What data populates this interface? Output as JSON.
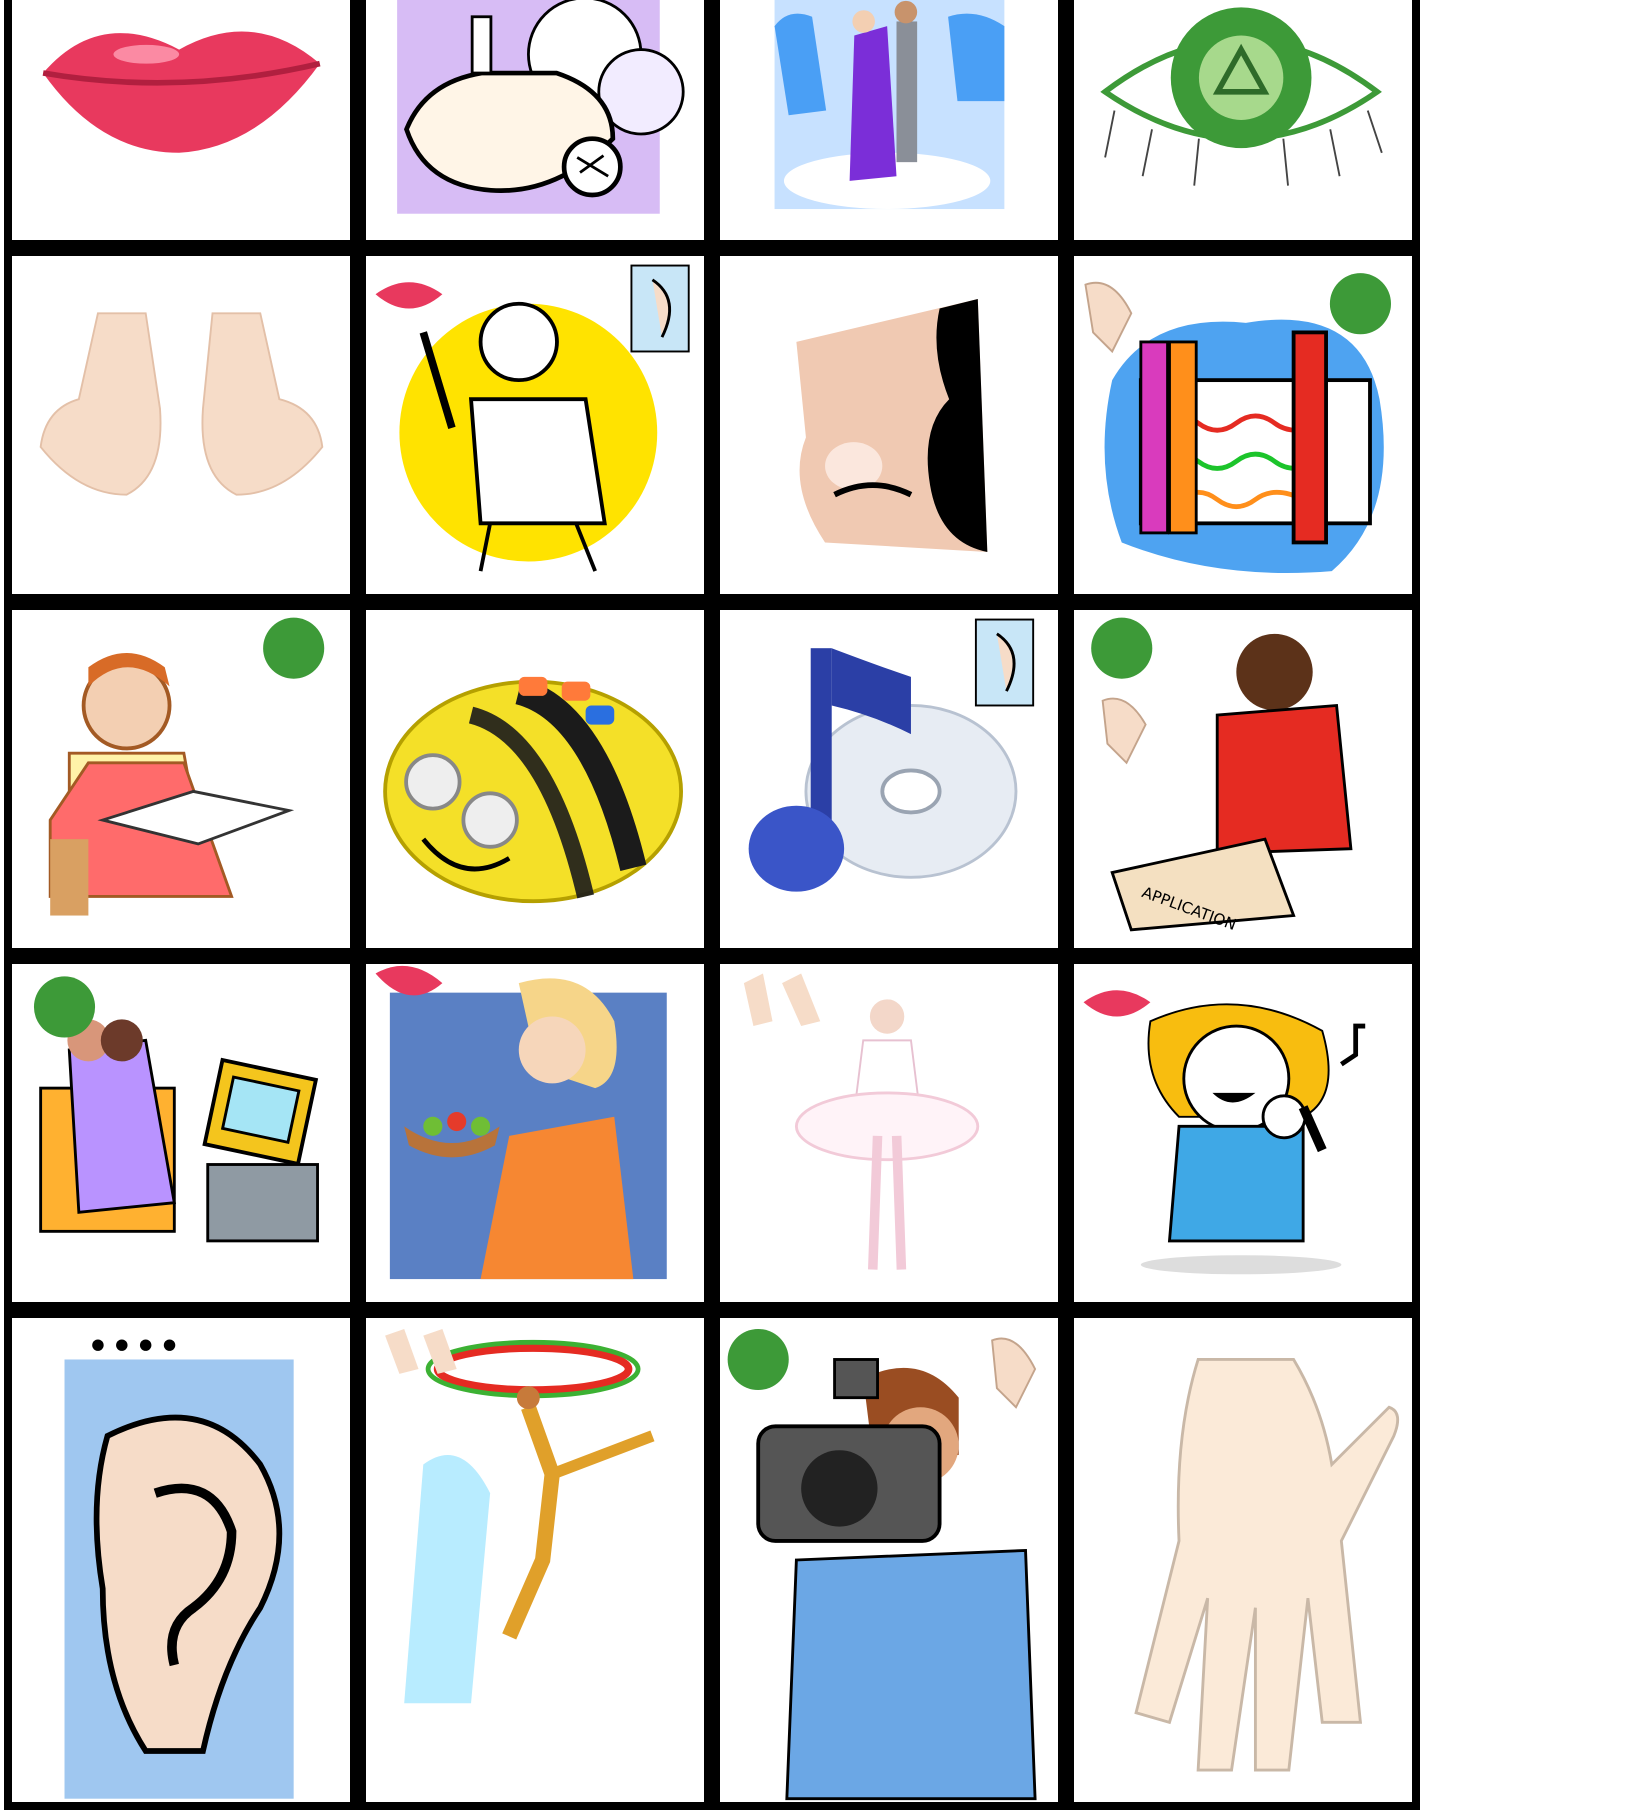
{
  "sheet": {
    "rows": [
      [
        "lips",
        "perfume",
        "dancing-couple",
        "eye"
      ],
      [
        "feet",
        "telephone-talker",
        "nose",
        "crayons-paper"
      ],
      [
        "girl-reading",
        "bee-bot-toy",
        "music-note-cd",
        "woman-writing-application"
      ],
      [
        "couple-watching-tv",
        "woman-eating-salad",
        "ballerina",
        "girl-singing"
      ],
      [
        "ear",
        "hula-hoop-dancer",
        "camera-operator",
        "hand"
      ]
    ],
    "printed_text": {
      "application_form": "APPLICATION"
    }
  },
  "colors": {
    "border": "#000000",
    "lip": "#e8395e",
    "eye_green": "#3d9a38",
    "skin_light": "#f6dcc8",
    "blue_silhouette": "#4a9ff5",
    "purple_dress": "#7b2ed8",
    "yellow": "#ffe300",
    "red": "#e52b22",
    "tv_blue_bg": "#5a80c4"
  }
}
